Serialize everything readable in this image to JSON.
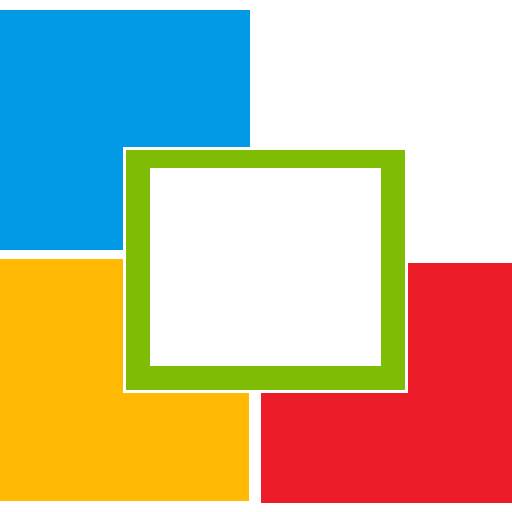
{
  "logo": {
    "blocks": [
      {
        "name": "blue",
        "color": "#0299e6"
      },
      {
        "name": "yellow",
        "color": "#ffb902"
      },
      {
        "name": "red",
        "color": "#ec1c28"
      }
    ],
    "frame": {
      "name": "green",
      "color": "#7fbc06",
      "inner_color": "#ffffff"
    },
    "background": "#ffffff"
  }
}
